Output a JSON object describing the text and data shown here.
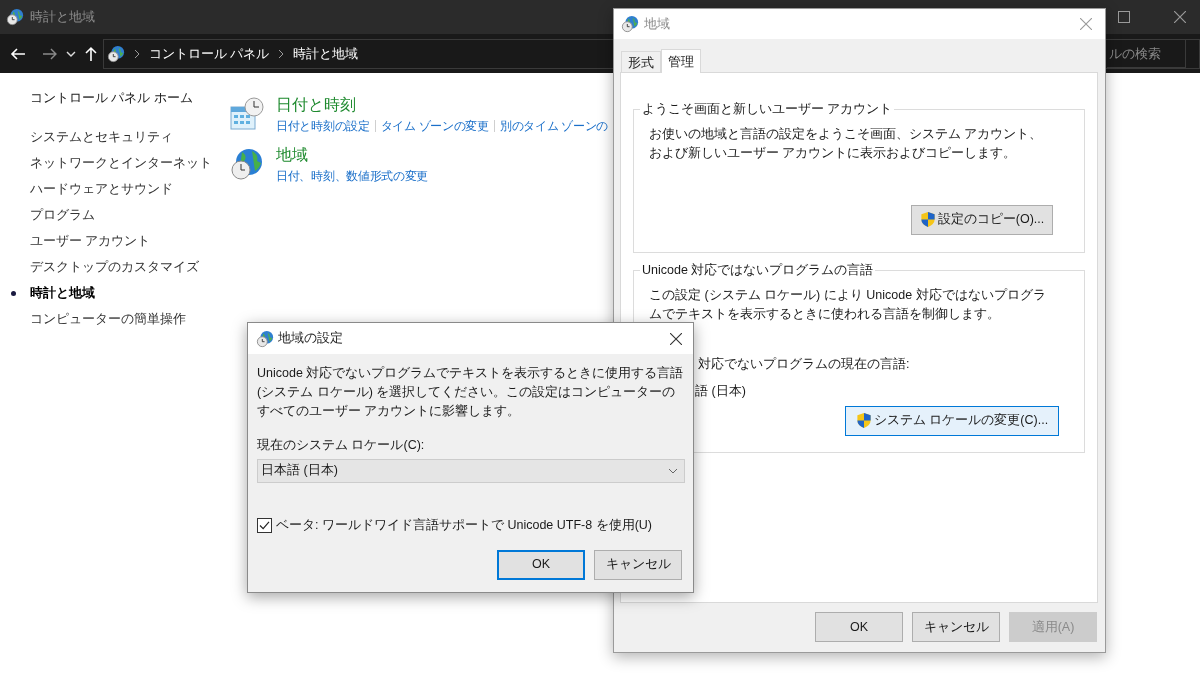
{
  "window": {
    "title": "時計と地域"
  },
  "address_bar": {
    "breadcrumbs": [
      "コントロール パネル",
      "時計と地域"
    ]
  },
  "search": {
    "placeholder": "ルの検索"
  },
  "sidebar": {
    "home": "コントロール パネル ホーム",
    "items": [
      {
        "label": "システムとセキュリティ",
        "selected": false
      },
      {
        "label": "ネットワークとインターネット",
        "selected": false
      },
      {
        "label": "ハードウェアとサウンド",
        "selected": false
      },
      {
        "label": "プログラム",
        "selected": false
      },
      {
        "label": "ユーザー アカウント",
        "selected": false
      },
      {
        "label": "デスクトップのカスタマイズ",
        "selected": false
      },
      {
        "label": "時計と地域",
        "selected": true
      },
      {
        "label": "コンピューターの簡単操作",
        "selected": false
      }
    ]
  },
  "categories": [
    {
      "title": "日付と時刻",
      "links": [
        "日付と時刻の設定",
        "タイム ゾーンの変更",
        "別のタイム ゾーンの"
      ]
    },
    {
      "title": "地域",
      "links": [
        "日付、時刻、数値形式の変更"
      ]
    }
  ],
  "region_dialog": {
    "title": "地域",
    "tabs": [
      {
        "label": "形式",
        "selected": false
      },
      {
        "label": "管理",
        "selected": true
      }
    ],
    "welcome_group": {
      "legend": "ようこそ画面と新しいユーザー アカウント",
      "description": "お使いの地域と言語の設定をようこそ画面、システム アカウント、および新しいユーザー アカウントに表示およびコピーします。",
      "button": "設定のコピー(O)..."
    },
    "unicode_group": {
      "legend": "Unicode 対応ではないプログラムの言語",
      "description": "この設定 (システム ロケール) により Unicode 対応ではないプログラムでテキストを表示するときに使われる言語を制御します。",
      "current_label": "対応でないプログラムの現在の言語:",
      "current_value": "語 (日本)",
      "button": "システム ロケールの変更(C)...",
      "button_focused": true
    },
    "buttons": [
      {
        "label": "OK",
        "disabled": false
      },
      {
        "label": "キャンセル",
        "disabled": false
      },
      {
        "label": "適用(A)",
        "disabled": true
      }
    ]
  },
  "locale_dialog": {
    "title": "地域の設定",
    "description": "Unicode 対応でないプログラムでテキストを表示するときに使用する言語 (システム ロケール) を選択してください。この設定はコンピューターのすべてのユーザー アカウントに影響します。",
    "locale_label": "現在のシステム ロケール(C):",
    "locale_value": "日本語 (日本)",
    "utf8_checkbox": {
      "label": "ベータ: ワールドワイド言語サポートで Unicode UTF-8 を使用(U)",
      "checked": true
    },
    "buttons": [
      {
        "label": "OK",
        "default": true
      },
      {
        "label": "キャンセル",
        "default": false
      }
    ]
  }
}
